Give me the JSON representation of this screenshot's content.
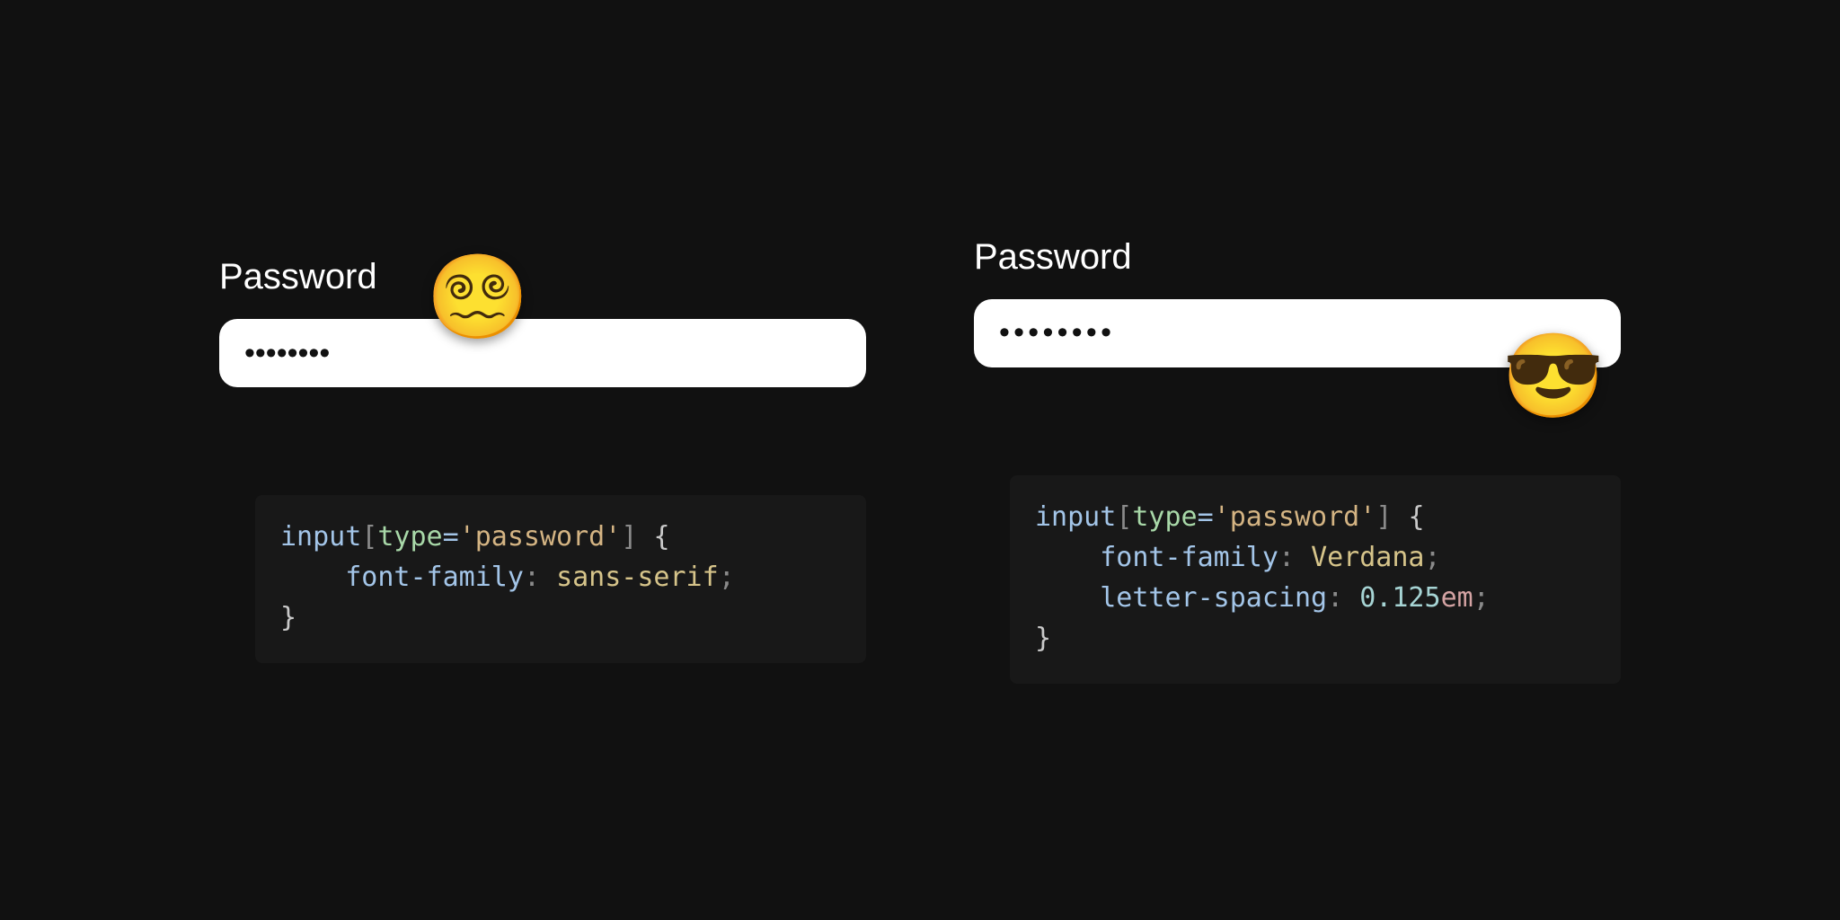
{
  "left": {
    "label": "Password",
    "value": "••••••••",
    "emoji": "😵‍💫",
    "code": {
      "selector": "input",
      "attr": "type",
      "attrval": "'password'",
      "prop1": "font-family",
      "val1": "sans-serif"
    }
  },
  "right": {
    "label": "Password",
    "value": "••••••••",
    "emoji": "😎",
    "code": {
      "selector": "input",
      "attr": "type",
      "attrval": "'password'",
      "prop1": "font-family",
      "val1": "Verdana",
      "prop2": "letter-spacing",
      "val2num": "0.125",
      "val2unit": "em"
    }
  }
}
